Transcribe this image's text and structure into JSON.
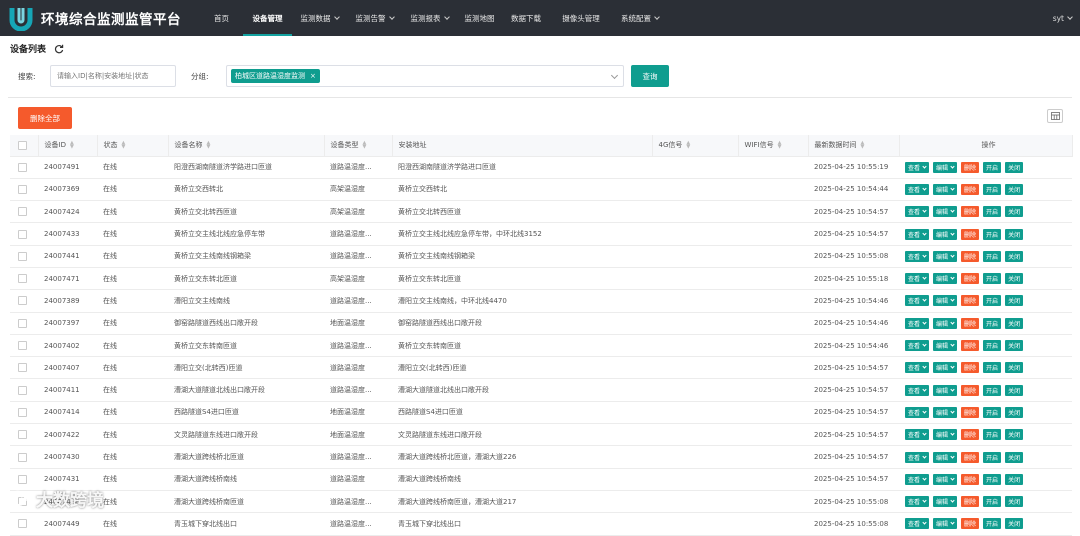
{
  "app": {
    "title": "环境综合监测监管平台",
    "accent": "#0f9d8f",
    "nav": [
      {
        "label": "首页",
        "dropdown": false,
        "active": false
      },
      {
        "label": "设备管理",
        "dropdown": false,
        "active": true
      },
      {
        "label": "监测数据",
        "dropdown": true,
        "active": false
      },
      {
        "label": "监测告警",
        "dropdown": true,
        "active": false
      },
      {
        "label": "监测报表",
        "dropdown": true,
        "active": false
      },
      {
        "label": "监测地图",
        "dropdown": false,
        "active": false
      },
      {
        "label": "数据下载",
        "dropdown": false,
        "active": false
      },
      {
        "label": "摄像头管理",
        "dropdown": false,
        "active": false
      },
      {
        "label": "系统配置",
        "dropdown": true,
        "active": false
      }
    ],
    "user": "syt"
  },
  "page": {
    "title": "设备列表",
    "search_label": "搜索:",
    "search_placeholder": "请输入ID|名称|安装地址|状态",
    "group_label": "分组:",
    "group_tag": "柏城区道路温湿度监测",
    "query_button": "查询",
    "delete_all_button": "删除全部"
  },
  "table": {
    "headers": [
      "设备ID",
      "状态",
      "设备名称",
      "设备类型",
      "安装地址",
      "4G信号",
      "WIFI信号",
      "最新数据时间",
      "操作"
    ],
    "actions": {
      "view": "查看",
      "edit": "编辑",
      "delete": "删除",
      "open": "开启",
      "close": "关闭"
    },
    "rows": [
      {
        "id": "24007491",
        "status": "在线",
        "name": "阳澄西湖南隧道济学路进口匝道",
        "type": "道路温湿度...",
        "address": "阳澄西湖南隧道济学路进口匝道",
        "g4": "",
        "wifi": "",
        "time": "2025-04-25 10:55:19"
      },
      {
        "id": "24007369",
        "status": "在线",
        "name": "黄桥立交西转北",
        "type": "高架温湿度",
        "address": "黄桥立交西转北",
        "g4": "",
        "wifi": "",
        "time": "2025-04-25 10:54:44"
      },
      {
        "id": "24007424",
        "status": "在线",
        "name": "黄桥立交北转西匝道",
        "type": "高架温湿度",
        "address": "黄桥立交北转西匝道",
        "g4": "",
        "wifi": "",
        "time": "2025-04-25 10:54:57"
      },
      {
        "id": "24007433",
        "status": "在线",
        "name": "黄桥立交主线北线应急停车带",
        "type": "道路温湿度...",
        "address": "黄桥立交主线北线应急停车带，中环北线3152",
        "g4": "",
        "wifi": "",
        "time": "2025-04-25 10:54:57"
      },
      {
        "id": "24007441",
        "status": "在线",
        "name": "黄桥立交主线南线钢箱梁",
        "type": "道路温湿度...",
        "address": "黄桥立交主线南线钢箱梁",
        "g4": "",
        "wifi": "",
        "time": "2025-04-25 10:55:08"
      },
      {
        "id": "24007471",
        "status": "在线",
        "name": "黄桥立交东转北匝道",
        "type": "高架温湿度",
        "address": "黄桥立交东转北匝道",
        "g4": "",
        "wifi": "",
        "time": "2025-04-25 10:55:18"
      },
      {
        "id": "24007389",
        "status": "在线",
        "name": "漕阳立交主线南线",
        "type": "道路温湿度...",
        "address": "漕阳立交主线南线，中环北线4470",
        "g4": "",
        "wifi": "",
        "time": "2025-04-25 10:54:46"
      },
      {
        "id": "24007397",
        "status": "在线",
        "name": "御窑路隧道西线出口敞开段",
        "type": "地面温湿度",
        "address": "御窑路隧道西线出口敞开段",
        "g4": "",
        "wifi": "",
        "time": "2025-04-25 10:54:46"
      },
      {
        "id": "24007402",
        "status": "在线",
        "name": "黄桥立交东转南匝道",
        "type": "道路温湿度...",
        "address": "黄桥立交东转南匝道",
        "g4": "",
        "wifi": "",
        "time": "2025-04-25 10:54:46"
      },
      {
        "id": "24007407",
        "status": "在线",
        "name": "漕阳立交(北转西)匝道",
        "type": "道路温湿度",
        "address": "漕阳立交(北转西)匝道",
        "g4": "",
        "wifi": "",
        "time": "2025-04-25 10:54:57"
      },
      {
        "id": "24007411",
        "status": "在线",
        "name": "漕湖大道隧道北线出口敞开段",
        "type": "道路温湿度...",
        "address": "漕湖大道隧道北线出口敞开段",
        "g4": "",
        "wifi": "",
        "time": "2025-04-25 10:54:57"
      },
      {
        "id": "24007414",
        "status": "在线",
        "name": "西路隧道S4进口匝道",
        "type": "地面温湿度",
        "address": "西路隧道S4进口匝道",
        "g4": "",
        "wifi": "",
        "time": "2025-04-25 10:54:57"
      },
      {
        "id": "24007422",
        "status": "在线",
        "name": "文灵路隧道东线进口敞开段",
        "type": "地面温湿度",
        "address": "文灵路隧道东线进口敞开段",
        "g4": "",
        "wifi": "",
        "time": "2025-04-25 10:54:57"
      },
      {
        "id": "24007430",
        "status": "在线",
        "name": "漕湖大道跨线桥北匝道",
        "type": "道路温湿度...",
        "address": "漕湖大道跨线桥北匝道，漕湖大道226",
        "g4": "",
        "wifi": "",
        "time": "2025-04-25 10:54:57"
      },
      {
        "id": "24007431",
        "status": "在线",
        "name": "漕湖大道跨线桥南线",
        "type": "道路温湿度",
        "address": "漕湖大道跨线桥南线",
        "g4": "",
        "wifi": "",
        "time": "2025-04-25 10:54:57"
      },
      {
        "id": "24007438",
        "status": "在线",
        "name": "漕湖大道跨线桥南匝道",
        "type": "道路温湿度...",
        "address": "漕湖大道跨线桥南匝道，漕湖大道217",
        "g4": "",
        "wifi": "",
        "time": "2025-04-25 10:55:08"
      },
      {
        "id": "24007449",
        "status": "在线",
        "name": "青玉城下穿北线出口",
        "type": "道路温湿度...",
        "address": "青玉城下穿北线出口",
        "g4": "",
        "wifi": "",
        "time": "2025-04-25 10:55:08"
      }
    ]
  },
  "watermark": "大数跨境"
}
